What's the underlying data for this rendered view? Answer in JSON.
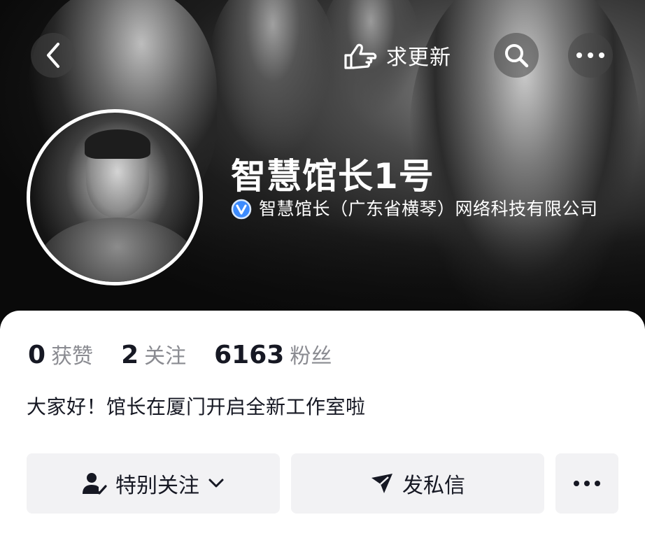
{
  "header": {
    "request_update_label": "求更新",
    "icons": {
      "back": "back-chevron-icon",
      "request_update": "hand-point-icon",
      "search": "search-icon",
      "more": "more-dots-icon"
    }
  },
  "profile": {
    "name": "智慧馆长1号",
    "verified_org": "智慧馆长（广东省横琴）网络科技有限公司",
    "verified_icon": "verified-v-icon",
    "accent_color": "#3d8bfd"
  },
  "stats": [
    {
      "value": "0",
      "label": "获赞"
    },
    {
      "value": "2",
      "label": "关注"
    },
    {
      "value": "6163",
      "label": "粉丝"
    }
  ],
  "bio": "大家好！馆长在厦门开启全新工作室啦",
  "actions": {
    "follow_label": "特别关注",
    "message_label": "发私信",
    "follow_icon": "user-check-icon",
    "dropdown_icon": "chevron-down-icon",
    "message_icon": "send-arrow-icon",
    "more_icon": "more-dots-icon"
  }
}
